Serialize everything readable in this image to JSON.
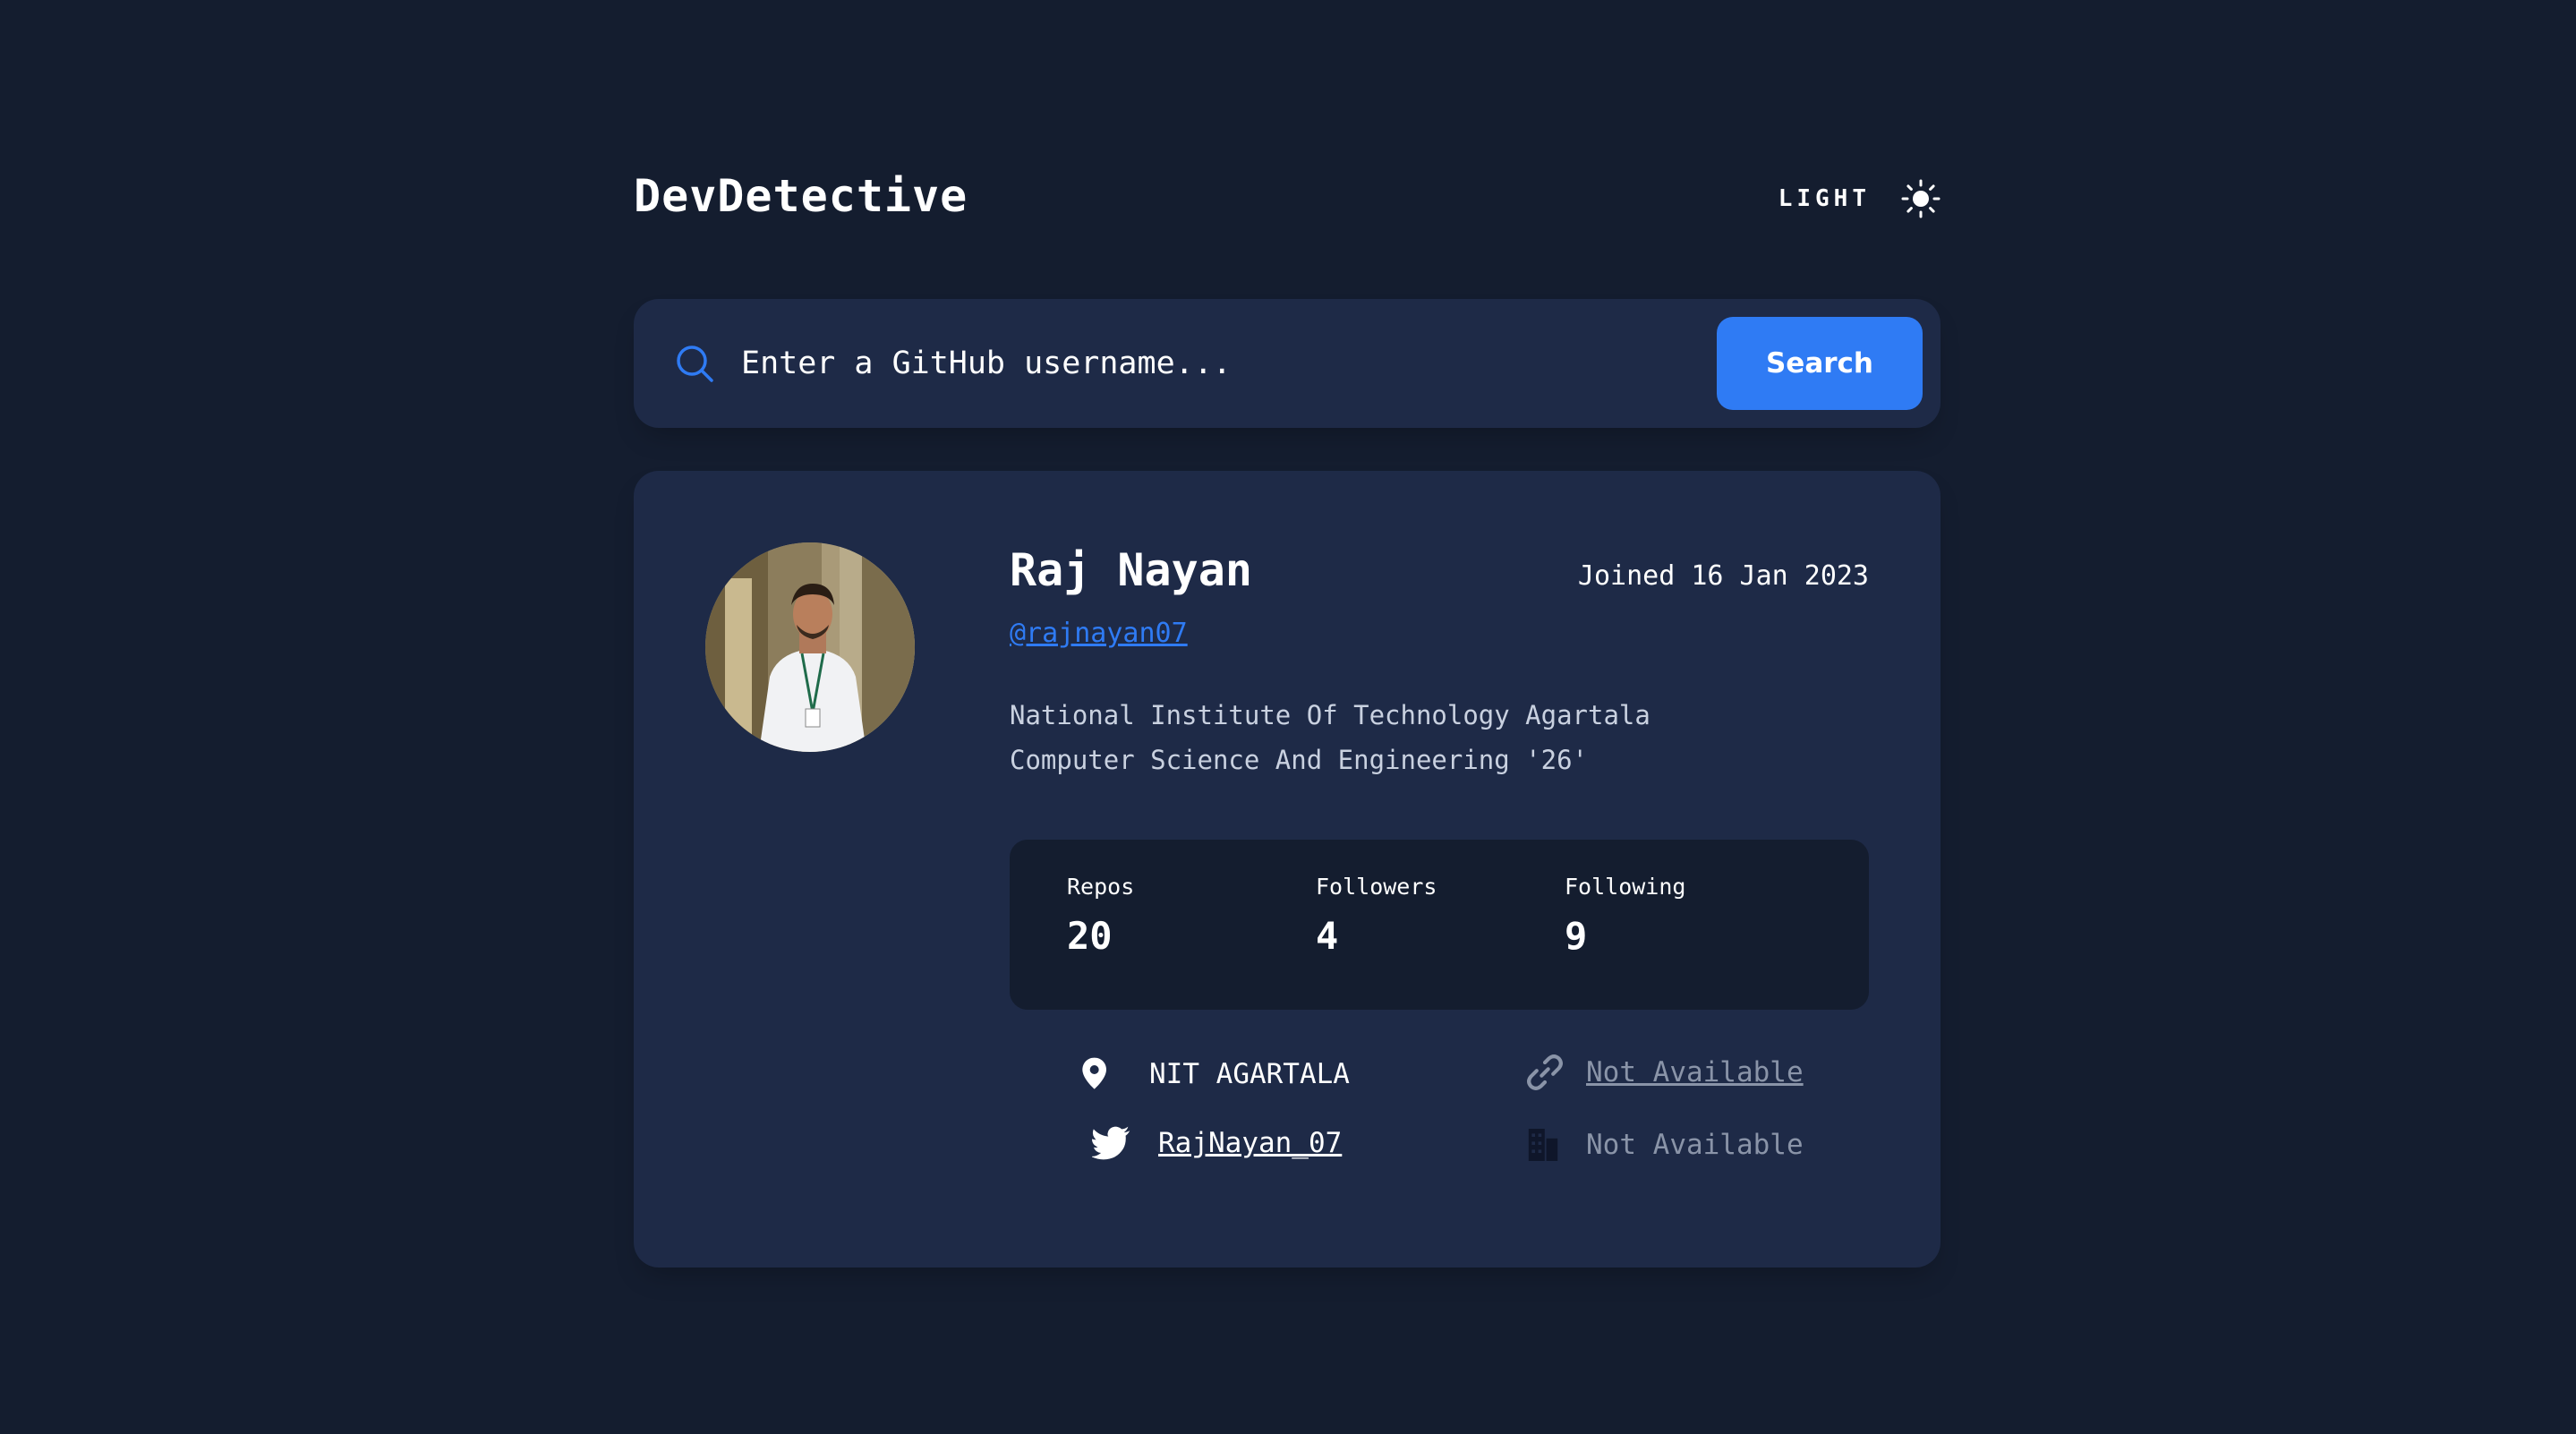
{
  "header": {
    "logo": "DevDetective",
    "theme_label": "LIGHT",
    "theme_icon": "sun-icon"
  },
  "search": {
    "placeholder": "Enter a GitHub username...",
    "button_label": "Search",
    "icon": "search-icon"
  },
  "profile": {
    "name": "Raj Nayan",
    "joined": "Joined 16 Jan 2023",
    "handle": "@rajnayan07",
    "bio_line1": "National Institute Of Technology Agartala",
    "bio_line2": "Computer Science And Engineering '26'",
    "avatar": "avatar-photo"
  },
  "stats": {
    "repos": {
      "label": "Repos",
      "value": "20"
    },
    "followers": {
      "label": "Followers",
      "value": "4"
    },
    "following": {
      "label": "Following",
      "value": "9"
    }
  },
  "links": {
    "location": {
      "icon": "location-pin-icon",
      "text": "NIT AGARTALA"
    },
    "website": {
      "icon": "link-icon",
      "text": "Not Available"
    },
    "twitter": {
      "icon": "twitter-icon",
      "text": "RajNayan_07"
    },
    "company": {
      "icon": "building-icon",
      "text": "Not Available"
    }
  },
  "colors": {
    "background": "#141d2f",
    "card": "#1e2a47",
    "accent": "#2f7bf4",
    "muted": "#8a94a8"
  }
}
